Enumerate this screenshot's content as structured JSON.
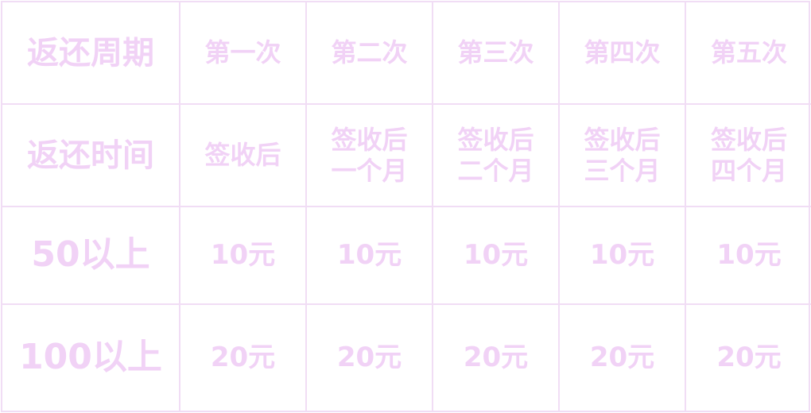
{
  "table": {
    "rows": [
      {
        "header": "返还周期",
        "cells": [
          "第一次",
          "第二次",
          "第三次",
          "第四次",
          "第五次"
        ]
      },
      {
        "header": "返还时间",
        "cells": [
          "签收后",
          "签收后\n一个月",
          "签收后\n二个月",
          "签收后\n三个月",
          "签收后\n四个月"
        ]
      },
      {
        "header": "50以上",
        "cells": [
          "10元",
          "10元",
          "10元",
          "10元",
          "10元"
        ]
      },
      {
        "header": "100以上",
        "cells": [
          "20元",
          "20元",
          "20元",
          "20元",
          "20元"
        ]
      }
    ]
  },
  "colors": {
    "text": "#f1d2f6",
    "border": "#f1ddf5",
    "background": "#ffffff"
  }
}
